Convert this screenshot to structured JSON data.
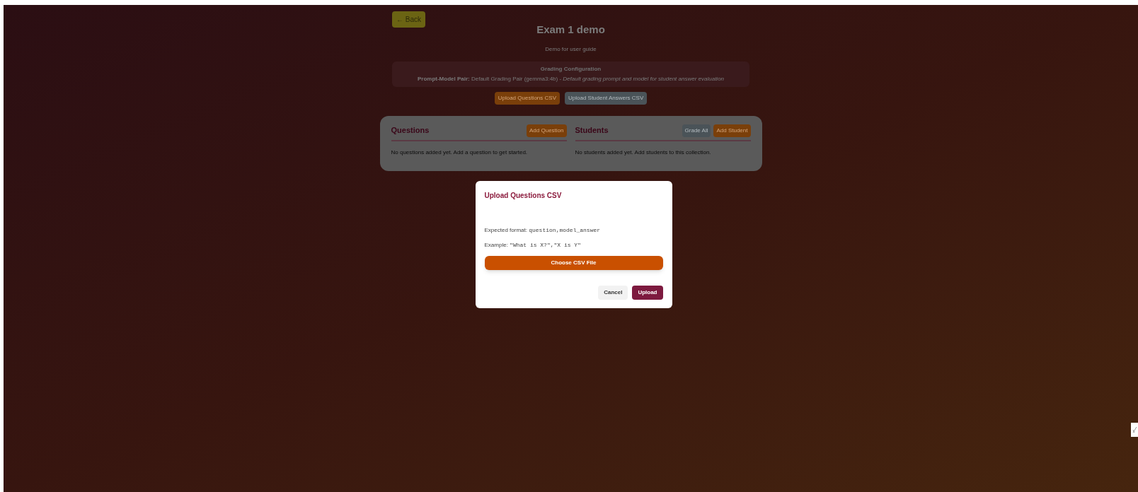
{
  "back_button": {
    "label": "← Back"
  },
  "title": "Exam 1 demo",
  "subtitle": "Demo for user guide",
  "grading_configuration": {
    "heading": "Grading Configuration",
    "text": "**Prompt-Model Pair:** Default Grading Pair (gemma3:4b) - *Default grading prompt and model for student answer evaluation*"
  },
  "upload_buttons": [
    {
      "label": "Upload Questions CSV",
      "kind": "primary"
    },
    {
      "label": "Upload Student Answers CSV",
      "kind": "secondary"
    }
  ],
  "panels": [
    {
      "heading": "Questions",
      "buttons": [
        {
          "label": "Add Question",
          "kind": "primary"
        }
      ],
      "empty_text": "No questions added yet. Add a question to get started."
    },
    {
      "heading": "Students",
      "buttons": [
        {
          "label": "Grade All",
          "kind": "secondary"
        },
        {
          "label": "Add Student",
          "kind": "primary"
        }
      ],
      "empty_text": "No students added yet. Add students to this collection."
    }
  ],
  "dialog": {
    "title": "Upload Questions CSV",
    "format_label": "Expected format:",
    "format_code": "question,model_answer",
    "example_label": "Example:",
    "example_code": "\"What is X?\",\"X is Y\"",
    "choose_button": "Choose CSV File",
    "cancel_button": "Cancel",
    "upload_button": "Upload"
  }
}
